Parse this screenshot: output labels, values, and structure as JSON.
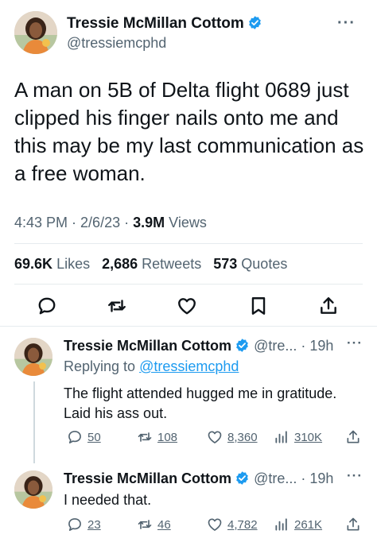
{
  "main_tweet": {
    "author_name": "Tressie McMillan Cottom",
    "handle": "@tressiemcphd",
    "text": "A man on 5B of Delta flight 0689 just clipped his finger nails onto me and this may be my last communication as a free woman.",
    "time": "4:43 PM",
    "date": "2/6/23",
    "views_count": "3.9M",
    "views_label": "Views",
    "likes_count": "69.6K",
    "likes_label": "Likes",
    "retweets_count": "2,686",
    "retweets_label": "Retweets",
    "quotes_count": "573",
    "quotes_label": "Quotes"
  },
  "replies": [
    {
      "author_name": "Tressie McMillan Cottom",
      "handle_short": "@tre...",
      "age": "· 19h",
      "replying_prefix": "Replying to",
      "replying_to": "@tressiemcphd",
      "text": "The flight attended hugged me in gratitude. Laid his ass out.",
      "replies": "50",
      "retweets": "108",
      "likes": "8,360",
      "views": "310K"
    },
    {
      "author_name": "Tressie McMillan Cottom",
      "handle_short": "@tre...",
      "age": "· 19h",
      "text": "I needed that.",
      "replies": "23",
      "retweets": "46",
      "likes": "4,782",
      "views": "261K"
    }
  ],
  "colors": {
    "verified": "#1d9bf0",
    "text": "#0f1419",
    "secondary": "#536471",
    "link": "#1d9bf0"
  },
  "icons": [
    "verified-badge-icon",
    "more-icon",
    "reply-icon",
    "retweet-icon",
    "like-icon",
    "bookmark-icon",
    "share-icon",
    "views-icon"
  ]
}
